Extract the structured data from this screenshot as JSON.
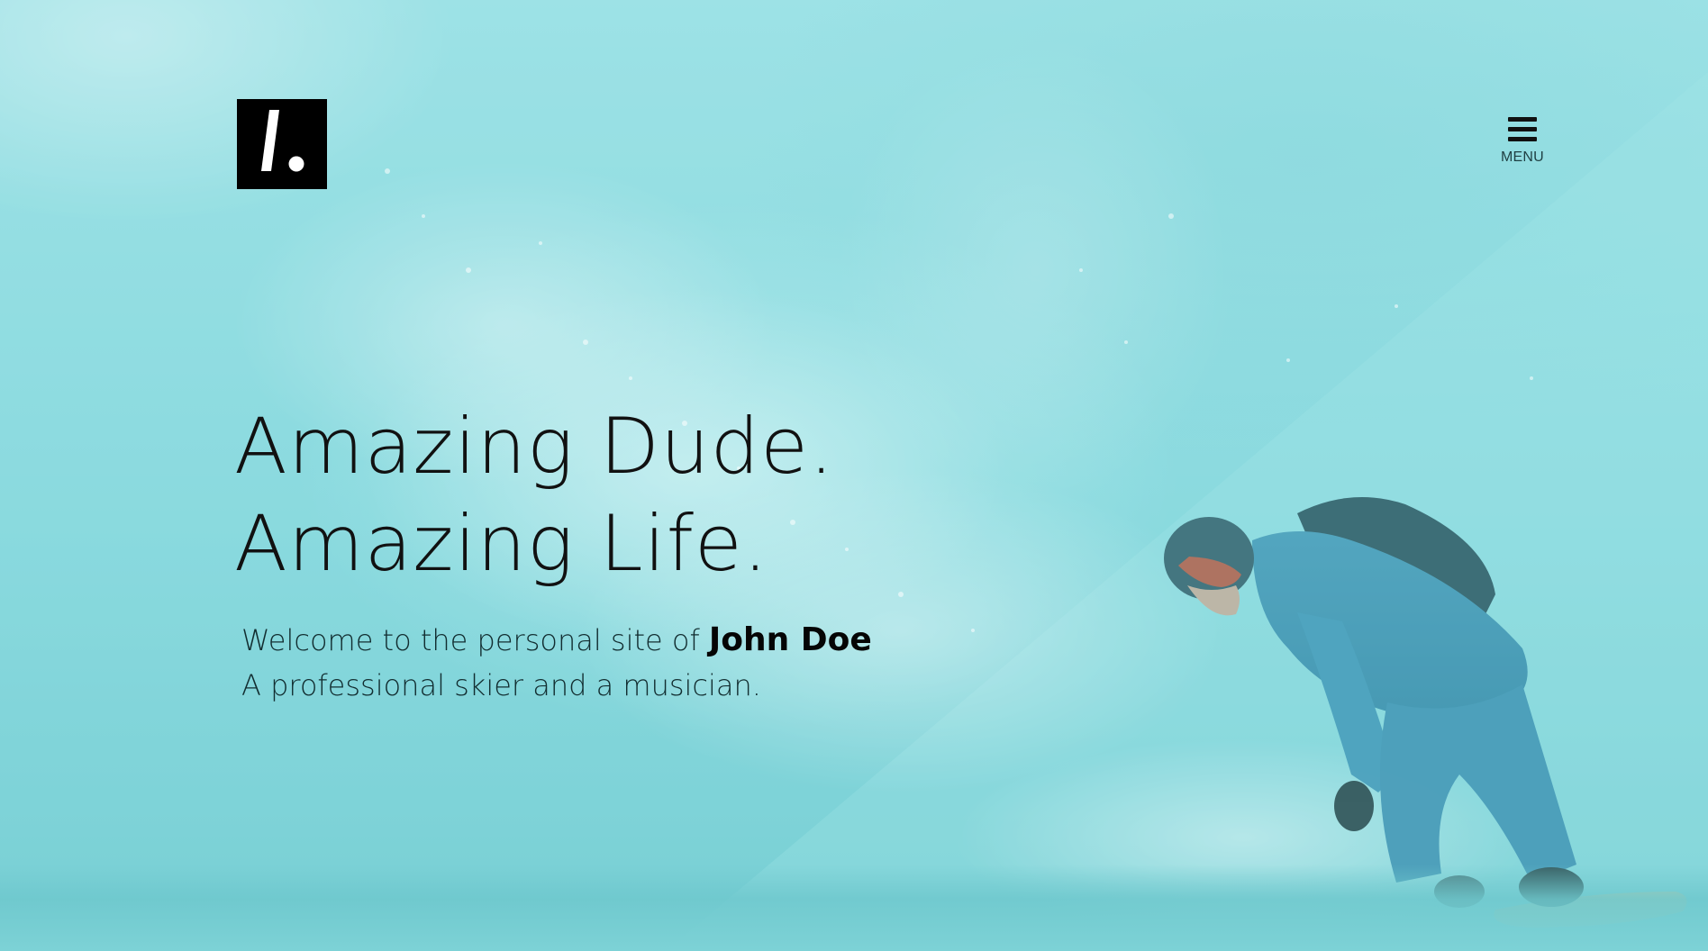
{
  "logo": {
    "glyph": "/.",
    "icon": "slash-dot-logo"
  },
  "menu": {
    "label": "MENU",
    "icon": "hamburger-icon"
  },
  "hero": {
    "headline_line1": "Amazing Dude.",
    "headline_line2": "Amazing Life.",
    "welcome_prefix": "Welcome to the personal site of ",
    "name": "John Doe",
    "tagline": "A professional skier and a musician.",
    "background": "snowboarder carving through powder snow, cyan tint"
  },
  "colors": {
    "tint": "#8fdbe0",
    "text": "#111111",
    "logo_bg": "#000000"
  }
}
